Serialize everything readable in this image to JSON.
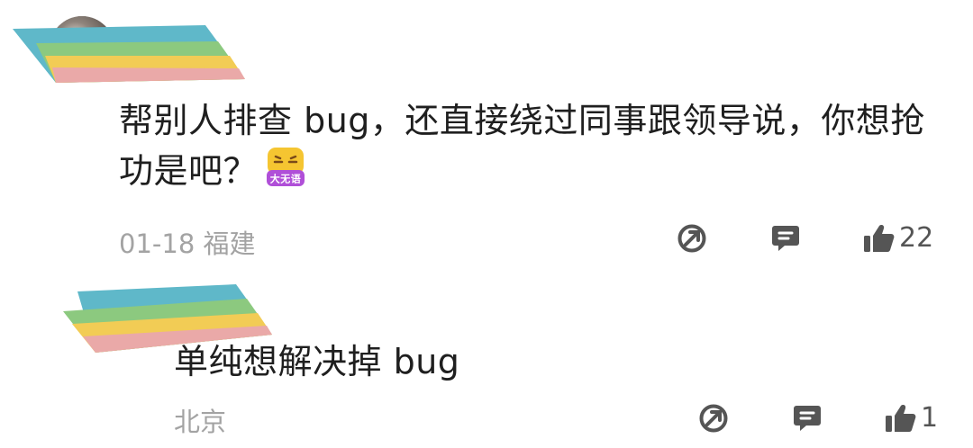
{
  "comments": [
    {
      "text": "帮别人排查 bug，还直接绕过同事跟领导说，你想抢功是吧？",
      "sticker_label": "大无语",
      "meta": "01-18 福建",
      "likes": "22"
    },
    {
      "text": "单纯想解决掉 bug",
      "meta": "北京",
      "likes": "1"
    }
  ],
  "icons": {
    "share": "share-icon",
    "reply": "reply-icon",
    "like": "thumbs-up-icon"
  },
  "colors": {
    "text": "#1f1f1f",
    "meta": "#a3a3a3",
    "icon": "#555555",
    "sticker": "#f5c531",
    "sticker_label_bg": "#b04fd8"
  }
}
